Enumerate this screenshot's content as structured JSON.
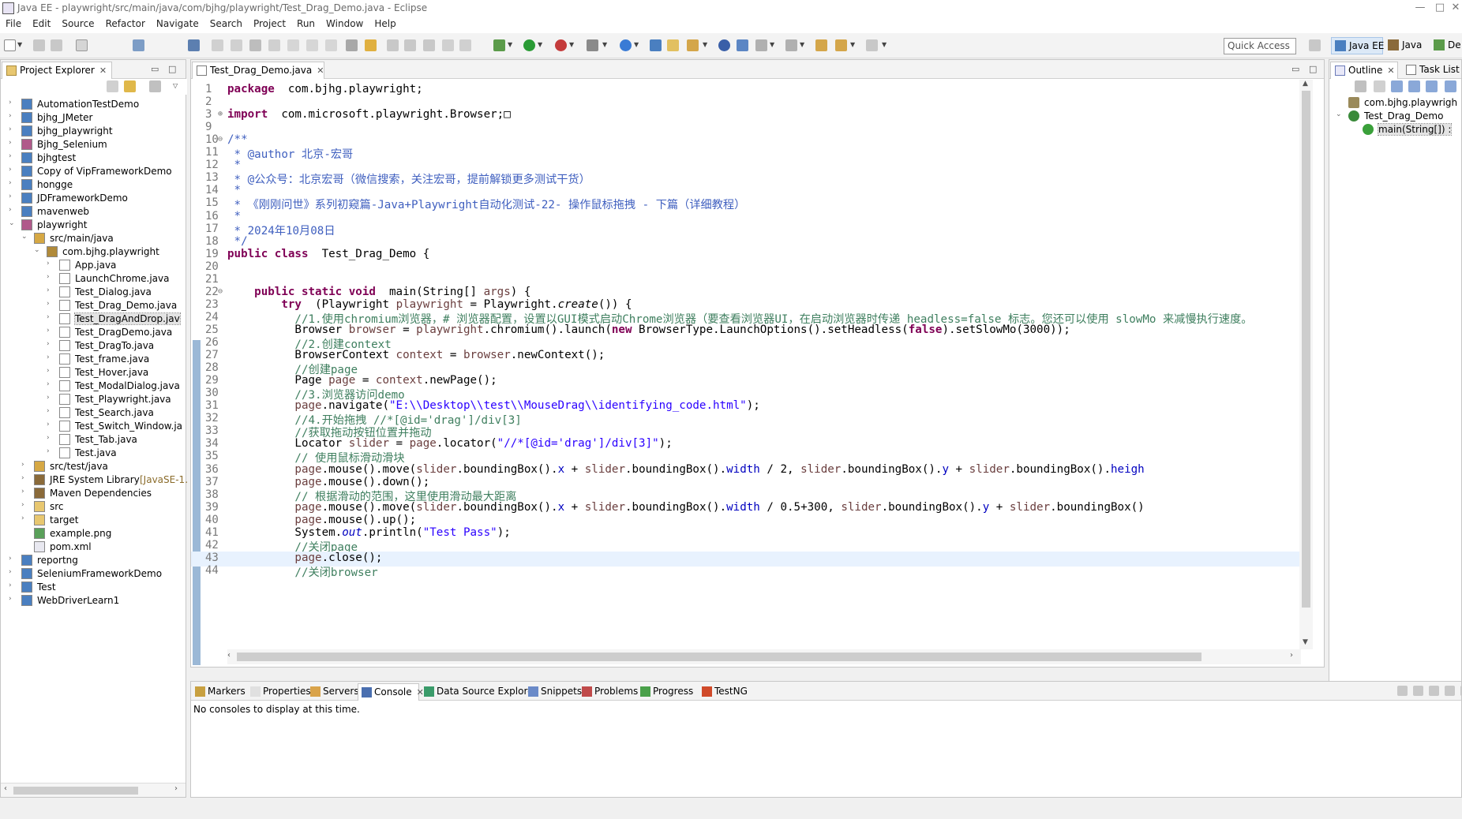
{
  "window": {
    "title": "Java EE - playwright/src/main/java/com/bjhg/playwright/Test_Drag_Demo.java - Eclipse",
    "controls": [
      "—",
      "□",
      "✕"
    ]
  },
  "menu": [
    "File",
    "Edit",
    "Source",
    "Refactor",
    "Navigate",
    "Search",
    "Project",
    "Run",
    "Window",
    "Help"
  ],
  "toolbar": {
    "quick_access": "Quick Access",
    "perspectives": [
      {
        "label": "Java EE",
        "active": true
      },
      {
        "label": "Java",
        "active": false
      },
      {
        "label": "De",
        "active": false
      }
    ]
  },
  "project_explorer": {
    "tab_label": "Project Explorer",
    "tree": [
      {
        "label": "AutomationTestDemo",
        "depth": 0,
        "arrow": "›",
        "icon": "project-icon"
      },
      {
        "label": "bjhg_JMeter",
        "depth": 0,
        "arrow": "›",
        "icon": "project-icon"
      },
      {
        "label": "bjhg_playwright",
        "depth": 0,
        "arrow": "›",
        "icon": "project-icon"
      },
      {
        "label": "Bjhg_Selenium",
        "depth": 0,
        "arrow": "›",
        "icon": "maven-project-icon"
      },
      {
        "label": "bjhgtest",
        "depth": 0,
        "arrow": "›",
        "icon": "project-icon"
      },
      {
        "label": "Copy of VipFrameworkDemo",
        "depth": 0,
        "arrow": "›",
        "icon": "project-icon"
      },
      {
        "label": "hongge",
        "depth": 0,
        "arrow": "›",
        "icon": "project-icon"
      },
      {
        "label": "JDFrameworkDemo",
        "depth": 0,
        "arrow": "›",
        "icon": "project-icon"
      },
      {
        "label": "mavenweb",
        "depth": 0,
        "arrow": "›",
        "icon": "project-icon"
      },
      {
        "label": "playwright",
        "depth": 0,
        "arrow": "⌄",
        "icon": "maven-project-icon"
      },
      {
        "label": "src/main/java",
        "depth": 1,
        "arrow": "⌄",
        "icon": "source-folder-icon"
      },
      {
        "label": "com.bjhg.playwright",
        "depth": 2,
        "arrow": "⌄",
        "icon": "package-icon"
      },
      {
        "label": "App.java",
        "depth": 3,
        "arrow": "›",
        "icon": "java-file-icon"
      },
      {
        "label": "LaunchChrome.java",
        "depth": 3,
        "arrow": "›",
        "icon": "java-file-icon"
      },
      {
        "label": "Test_Dialog.java",
        "depth": 3,
        "arrow": "›",
        "icon": "java-file-icon"
      },
      {
        "label": "Test_Drag_Demo.java",
        "depth": 3,
        "arrow": "›",
        "icon": "java-file-icon"
      },
      {
        "label": "Test_DragAndDrop.jav",
        "depth": 3,
        "arrow": "›",
        "icon": "java-file-icon",
        "selected": true
      },
      {
        "label": "Test_DragDemo.java",
        "depth": 3,
        "arrow": "›",
        "icon": "java-file-icon"
      },
      {
        "label": "Test_DragTo.java",
        "depth": 3,
        "arrow": "›",
        "icon": "java-file-icon"
      },
      {
        "label": "Test_frame.java",
        "depth": 3,
        "arrow": "›",
        "icon": "java-file-icon"
      },
      {
        "label": "Test_Hover.java",
        "depth": 3,
        "arrow": "›",
        "icon": "java-file-icon"
      },
      {
        "label": "Test_ModalDialog.java",
        "depth": 3,
        "arrow": "›",
        "icon": "java-file-icon"
      },
      {
        "label": "Test_Playwright.java",
        "depth": 3,
        "arrow": "›",
        "icon": "java-file-icon"
      },
      {
        "label": "Test_Search.java",
        "depth": 3,
        "arrow": "›",
        "icon": "java-file-icon"
      },
      {
        "label": "Test_Switch_Window.ja",
        "depth": 3,
        "arrow": "›",
        "icon": "java-file-icon"
      },
      {
        "label": "Test_Tab.java",
        "depth": 3,
        "arrow": "›",
        "icon": "java-file-icon"
      },
      {
        "label": "Test.java",
        "depth": 3,
        "arrow": "›",
        "icon": "java-file-icon"
      },
      {
        "label": "src/test/java",
        "depth": 1,
        "arrow": "›",
        "icon": "source-folder-icon"
      },
      {
        "label": "JRE System Library",
        "decoration": "[JavaSE-1.",
        "depth": 1,
        "arrow": "›",
        "icon": "library-icon"
      },
      {
        "label": "Maven Dependencies",
        "depth": 1,
        "arrow": "›",
        "icon": "library-icon"
      },
      {
        "label": "src",
        "depth": 1,
        "arrow": "›",
        "icon": "folder-icon"
      },
      {
        "label": "target",
        "depth": 1,
        "arrow": "›",
        "icon": "folder-icon"
      },
      {
        "label": "example.png",
        "depth": 1,
        "arrow": "",
        "icon": "image-file-icon"
      },
      {
        "label": "pom.xml",
        "depth": 1,
        "arrow": "",
        "icon": "xml-file-icon"
      },
      {
        "label": "reportng",
        "depth": 0,
        "arrow": "›",
        "icon": "project-icon"
      },
      {
        "label": "SeleniumFrameworkDemo",
        "depth": 0,
        "arrow": "›",
        "icon": "project-icon"
      },
      {
        "label": "Test",
        "depth": 0,
        "arrow": "›",
        "icon": "project-icon"
      },
      {
        "label": "WebDriverLearn1",
        "depth": 0,
        "arrow": "›",
        "icon": "project-icon"
      }
    ]
  },
  "editor": {
    "tab_label": "Test_Drag_Demo.java",
    "current_line": 43,
    "lines": [
      {
        "n": "1",
        "fold": "",
        "segs": [
          [
            "kw",
            "package"
          ],
          [
            "",
            "  com.bjhg.playwright;"
          ]
        ]
      },
      {
        "n": "2",
        "fold": "",
        "segs": []
      },
      {
        "n": "3",
        "fold": "⊕",
        "segs": [
          [
            "kw",
            "import"
          ],
          [
            "",
            "  com.microsoft.playwright.Browser;□"
          ]
        ]
      },
      {
        "n": "9",
        "fold": "",
        "segs": []
      },
      {
        "n": "10",
        "fold": "⊖",
        "segs": [
          [
            "jd",
            "/**"
          ]
        ]
      },
      {
        "n": "11",
        "fold": "",
        "segs": [
          [
            "jd",
            " * @author 北京-宏哥"
          ]
        ]
      },
      {
        "n": "12",
        "fold": "",
        "segs": [
          [
            "jd",
            " *"
          ]
        ]
      },
      {
        "n": "13",
        "fold": "",
        "segs": [
          [
            "jd",
            " * @公众号：北京宏哥（微信搜索，关注宏哥，提前解锁更多测试干货）"
          ]
        ]
      },
      {
        "n": "14",
        "fold": "",
        "segs": [
          [
            "jd",
            " *"
          ]
        ]
      },
      {
        "n": "15",
        "fold": "",
        "segs": [
          [
            "jd",
            " * 《刚刚问世》系列初窥篇-Java+Playwright自动化测试-22- 操作鼠标拖拽 - 下篇（详细教程）"
          ]
        ]
      },
      {
        "n": "16",
        "fold": "",
        "segs": [
          [
            "jd",
            " *"
          ]
        ]
      },
      {
        "n": "17",
        "fold": "",
        "segs": [
          [
            "jd",
            " * 2024年10月08日"
          ]
        ]
      },
      {
        "n": "18",
        "fold": "",
        "segs": [
          [
            "jd",
            " */"
          ]
        ]
      },
      {
        "n": "19",
        "fold": "",
        "segs": [
          [
            "kw",
            "public class"
          ],
          [
            "",
            "  Test_Drag_Demo {"
          ]
        ]
      },
      {
        "n": "20",
        "fold": "",
        "segs": []
      },
      {
        "n": "21",
        "fold": "",
        "segs": []
      },
      {
        "n": "22",
        "fold": "⊖",
        "segs": [
          [
            "",
            "    "
          ],
          [
            "kw",
            "public static void"
          ],
          [
            "",
            "  main(String[] "
          ],
          [
            "var",
            "args"
          ],
          [
            "",
            ") {"
          ]
        ]
      },
      {
        "n": "23",
        "fold": "",
        "segs": [
          [
            "",
            "        "
          ],
          [
            "kw",
            "try"
          ],
          [
            "",
            "  (Playwright "
          ],
          [
            "var",
            "playwright"
          ],
          [
            "",
            " = Playwright."
          ],
          [
            "it",
            "create"
          ],
          [
            "",
            "()) {"
          ]
        ]
      },
      {
        "n": "24",
        "fold": "",
        "segs": [
          [
            "",
            "          "
          ],
          [
            "cm",
            "//1.使用chromium浏览器，# 浏览器配置，设置以GUI模式启动Chrome浏览器（要查看浏览器UI，在启动浏览器时传递 headless=false 标志。您还可以使用 slowMo 来减慢执行速度。"
          ]
        ]
      },
      {
        "n": "25",
        "fold": "",
        "segs": [
          [
            "",
            "          Browser "
          ],
          [
            "var",
            "browser"
          ],
          [
            "",
            " = "
          ],
          [
            "var",
            "playwright"
          ],
          [
            "",
            ".chromium().launch("
          ],
          [
            "kw",
            "new"
          ],
          [
            "",
            " BrowserType.LaunchOptions().setHeadless("
          ],
          [
            "kw",
            "false"
          ],
          [
            "",
            ").setSlowMo(3000));"
          ]
        ]
      },
      {
        "n": "26",
        "fold": "",
        "segs": [
          [
            "",
            "          "
          ],
          [
            "cm",
            "//2.创建context"
          ]
        ]
      },
      {
        "n": "27",
        "fold": "",
        "segs": [
          [
            "",
            "          BrowserContext "
          ],
          [
            "var",
            "context"
          ],
          [
            "",
            " = "
          ],
          [
            "var",
            "browser"
          ],
          [
            "",
            ".newContext();"
          ]
        ]
      },
      {
        "n": "28",
        "fold": "",
        "segs": [
          [
            "",
            "          "
          ],
          [
            "cm",
            "//创建page"
          ]
        ]
      },
      {
        "n": "29",
        "fold": "",
        "segs": [
          [
            "",
            "          Page "
          ],
          [
            "var",
            "page"
          ],
          [
            "",
            " = "
          ],
          [
            "var",
            "context"
          ],
          [
            "",
            ".newPage();"
          ]
        ]
      },
      {
        "n": "30",
        "fold": "",
        "segs": [
          [
            "",
            "          "
          ],
          [
            "cm",
            "//3.浏览器访问demo"
          ]
        ]
      },
      {
        "n": "31",
        "fold": "",
        "segs": [
          [
            "",
            "          "
          ],
          [
            "var",
            "page"
          ],
          [
            "",
            ".navigate("
          ],
          [
            "st",
            "\"E:\\\\Desktop\\\\test\\\\MouseDrag\\\\identifying_code.html\""
          ],
          [
            "",
            ");"
          ]
        ]
      },
      {
        "n": "32",
        "fold": "",
        "segs": [
          [
            "",
            "          "
          ],
          [
            "cm",
            "//4.开始拖拽 //*[@id='drag']/div[3]"
          ]
        ]
      },
      {
        "n": "33",
        "fold": "",
        "segs": [
          [
            "",
            "          "
          ],
          [
            "cm",
            "//获取拖动按钮位置并拖动"
          ]
        ]
      },
      {
        "n": "34",
        "fold": "",
        "segs": [
          [
            "",
            "          Locator "
          ],
          [
            "var",
            "slider"
          ],
          [
            "",
            " = "
          ],
          [
            "var",
            "page"
          ],
          [
            "",
            ".locator("
          ],
          [
            "st",
            "\"//*[@id='drag']/div[3]\""
          ],
          [
            "",
            ");"
          ]
        ]
      },
      {
        "n": "35",
        "fold": "",
        "segs": [
          [
            "",
            "          "
          ],
          [
            "cm",
            "// 使用鼠标滑动滑块"
          ]
        ]
      },
      {
        "n": "36",
        "fold": "",
        "segs": [
          [
            "",
            "          "
          ],
          [
            "var",
            "page"
          ],
          [
            "",
            ".mouse().move("
          ],
          [
            "var",
            "slider"
          ],
          [
            "",
            ".boundingBox()."
          ],
          [
            "fld",
            "x"
          ],
          [
            "",
            " + "
          ],
          [
            "var",
            "slider"
          ],
          [
            "",
            ".boundingBox()."
          ],
          [
            "fld",
            "width"
          ],
          [
            "",
            " / 2, "
          ],
          [
            "var",
            "slider"
          ],
          [
            "",
            ".boundingBox()."
          ],
          [
            "fld",
            "y"
          ],
          [
            "",
            " + "
          ],
          [
            "var",
            "slider"
          ],
          [
            "",
            ".boundingBox()."
          ],
          [
            "fld",
            "heigh"
          ]
        ]
      },
      {
        "n": "37",
        "fold": "",
        "segs": [
          [
            "",
            "          "
          ],
          [
            "var",
            "page"
          ],
          [
            "",
            ".mouse().down();"
          ]
        ]
      },
      {
        "n": "38",
        "fold": "",
        "segs": [
          [
            "",
            "          "
          ],
          [
            "cm",
            "// 根据滑动的范围，这里使用滑动最大距离"
          ]
        ]
      },
      {
        "n": "39",
        "fold": "",
        "segs": [
          [
            "",
            "          "
          ],
          [
            "var",
            "page"
          ],
          [
            "",
            ".mouse().move("
          ],
          [
            "var",
            "slider"
          ],
          [
            "",
            ".boundingBox()."
          ],
          [
            "fld",
            "x"
          ],
          [
            "",
            " + "
          ],
          [
            "var",
            "slider"
          ],
          [
            "",
            ".boundingBox()."
          ],
          [
            "fld",
            "width"
          ],
          [
            "",
            " / 0.5+300, "
          ],
          [
            "var",
            "slider"
          ],
          [
            "",
            ".boundingBox()."
          ],
          [
            "fld",
            "y"
          ],
          [
            "",
            " + "
          ],
          [
            "var",
            "slider"
          ],
          [
            "",
            ".boundingBox()"
          ]
        ]
      },
      {
        "n": "40",
        "fold": "",
        "segs": [
          [
            "",
            "          "
          ],
          [
            "var",
            "page"
          ],
          [
            "",
            ".mouse().up();"
          ]
        ]
      },
      {
        "n": "41",
        "fold": "",
        "segs": [
          [
            "",
            "          System."
          ],
          [
            "fld it",
            "out"
          ],
          [
            "",
            ".println("
          ],
          [
            "st",
            "\"Test Pass\""
          ],
          [
            "",
            ");"
          ]
        ]
      },
      {
        "n": "42",
        "fold": "",
        "segs": [
          [
            "",
            "          "
          ],
          [
            "cm",
            "//关闭page"
          ]
        ]
      },
      {
        "n": "43",
        "fold": "",
        "segs": [
          [
            "",
            "          "
          ],
          [
            "var",
            "page"
          ],
          [
            "",
            ".close();"
          ]
        ]
      },
      {
        "n": "44",
        "fold": "",
        "segs": [
          [
            "",
            "          "
          ],
          [
            "cm",
            "//关闭browser"
          ]
        ]
      }
    ]
  },
  "outline": {
    "tab_label": "Outline",
    "task_list_label": "Task List",
    "items": [
      {
        "label": "com.bjhg.playwrigh",
        "depth": 0,
        "arrow": "",
        "icon": "package-decl-icon"
      },
      {
        "label": "Test_Drag_Demo",
        "depth": 0,
        "arrow": "⌄",
        "icon": "class-icon"
      },
      {
        "label": "main(String[]) :",
        "depth": 1,
        "arrow": "",
        "icon": "method-icon",
        "selected": true
      }
    ]
  },
  "bottom": {
    "tabs": [
      "Markers",
      "Properties",
      "Servers",
      "Console",
      "Data Source Explorer",
      "Snippets",
      "Problems",
      "Progress",
      "TestNG"
    ],
    "active_tab": "Console",
    "console_message": "No consoles to display at this time."
  }
}
